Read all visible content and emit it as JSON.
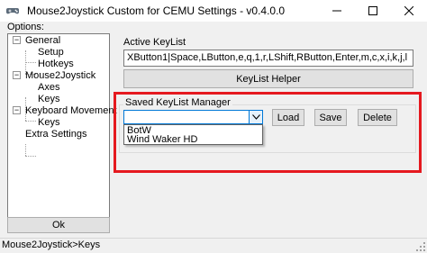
{
  "window": {
    "title": "Mouse2Joystick Custom for CEMU Settings  -  v0.4.0.0",
    "icon": "gamepad-icon",
    "controls": {
      "minimize": "minimize-icon",
      "maximize": "maximize-icon",
      "close": "close-icon"
    }
  },
  "options": {
    "label": "Options:",
    "tree": [
      {
        "label": "General",
        "level": 0,
        "expander": "−"
      },
      {
        "label": "Setup",
        "level": 1
      },
      {
        "label": "Hotkeys",
        "level": 1
      },
      {
        "label": "Mouse2Joystick",
        "level": 0,
        "expander": "−"
      },
      {
        "label": "Axes",
        "level": 1
      },
      {
        "label": "Keys",
        "level": 1
      },
      {
        "label": "Keyboard Movement",
        "level": 0,
        "expander": "−"
      },
      {
        "label": "Keys",
        "level": 1
      },
      {
        "label": "Extra Settings",
        "level": 0
      }
    ],
    "ok_label": "Ok"
  },
  "keylist": {
    "group_label": "Active KeyList",
    "value": "XButton1|Space,LButton,e,q,1,r,LShift,RButton,Enter,m,c,x,i,k,j,l",
    "helper_label": "KeyList Helper"
  },
  "saved": {
    "group_label": "Saved KeyList Manager",
    "combo_value": "",
    "options": [
      "BotW",
      "Wind Waker HD"
    ],
    "load_label": "Load",
    "save_label": "Save",
    "delete_label": "Delete",
    "highlight_color": "#e5191f"
  },
  "statusbar": {
    "text": "Mouse2Joystick>Keys"
  }
}
